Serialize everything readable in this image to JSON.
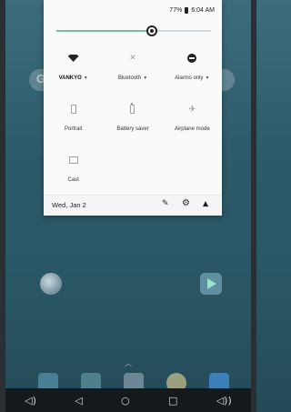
{
  "status_bar": {
    "battery": "77%",
    "time": "6:04 AM"
  },
  "brightness": {
    "level": 0.62
  },
  "quick_settings": {
    "tiles": [
      {
        "label": "VANKYO",
        "icon": "wifi-icon",
        "dropdown": true,
        "active": true
      },
      {
        "label": "Bluetooth",
        "icon": "bluetooth-off-icon",
        "dropdown": true,
        "active": false
      },
      {
        "label": "Alarms only",
        "icon": "do-not-disturb-icon",
        "dropdown": true,
        "active": true
      },
      {
        "label": "Portrait",
        "icon": "portrait-icon",
        "dropdown": false,
        "active": false
      },
      {
        "label": "Battery saver",
        "icon": "battery-saver-icon",
        "dropdown": false,
        "active": false
      },
      {
        "label": "Airplane mode",
        "icon": "airplane-mode-icon",
        "dropdown": false,
        "active": false
      },
      {
        "label": "Cast",
        "icon": "cast-icon",
        "dropdown": false,
        "active": false
      }
    ]
  },
  "footer": {
    "date": "Wed, Jan 2"
  },
  "colors": {
    "accent": "#7cb9a8",
    "shade_bg": "#fafafa",
    "wallpaper": "#2c5a69"
  }
}
